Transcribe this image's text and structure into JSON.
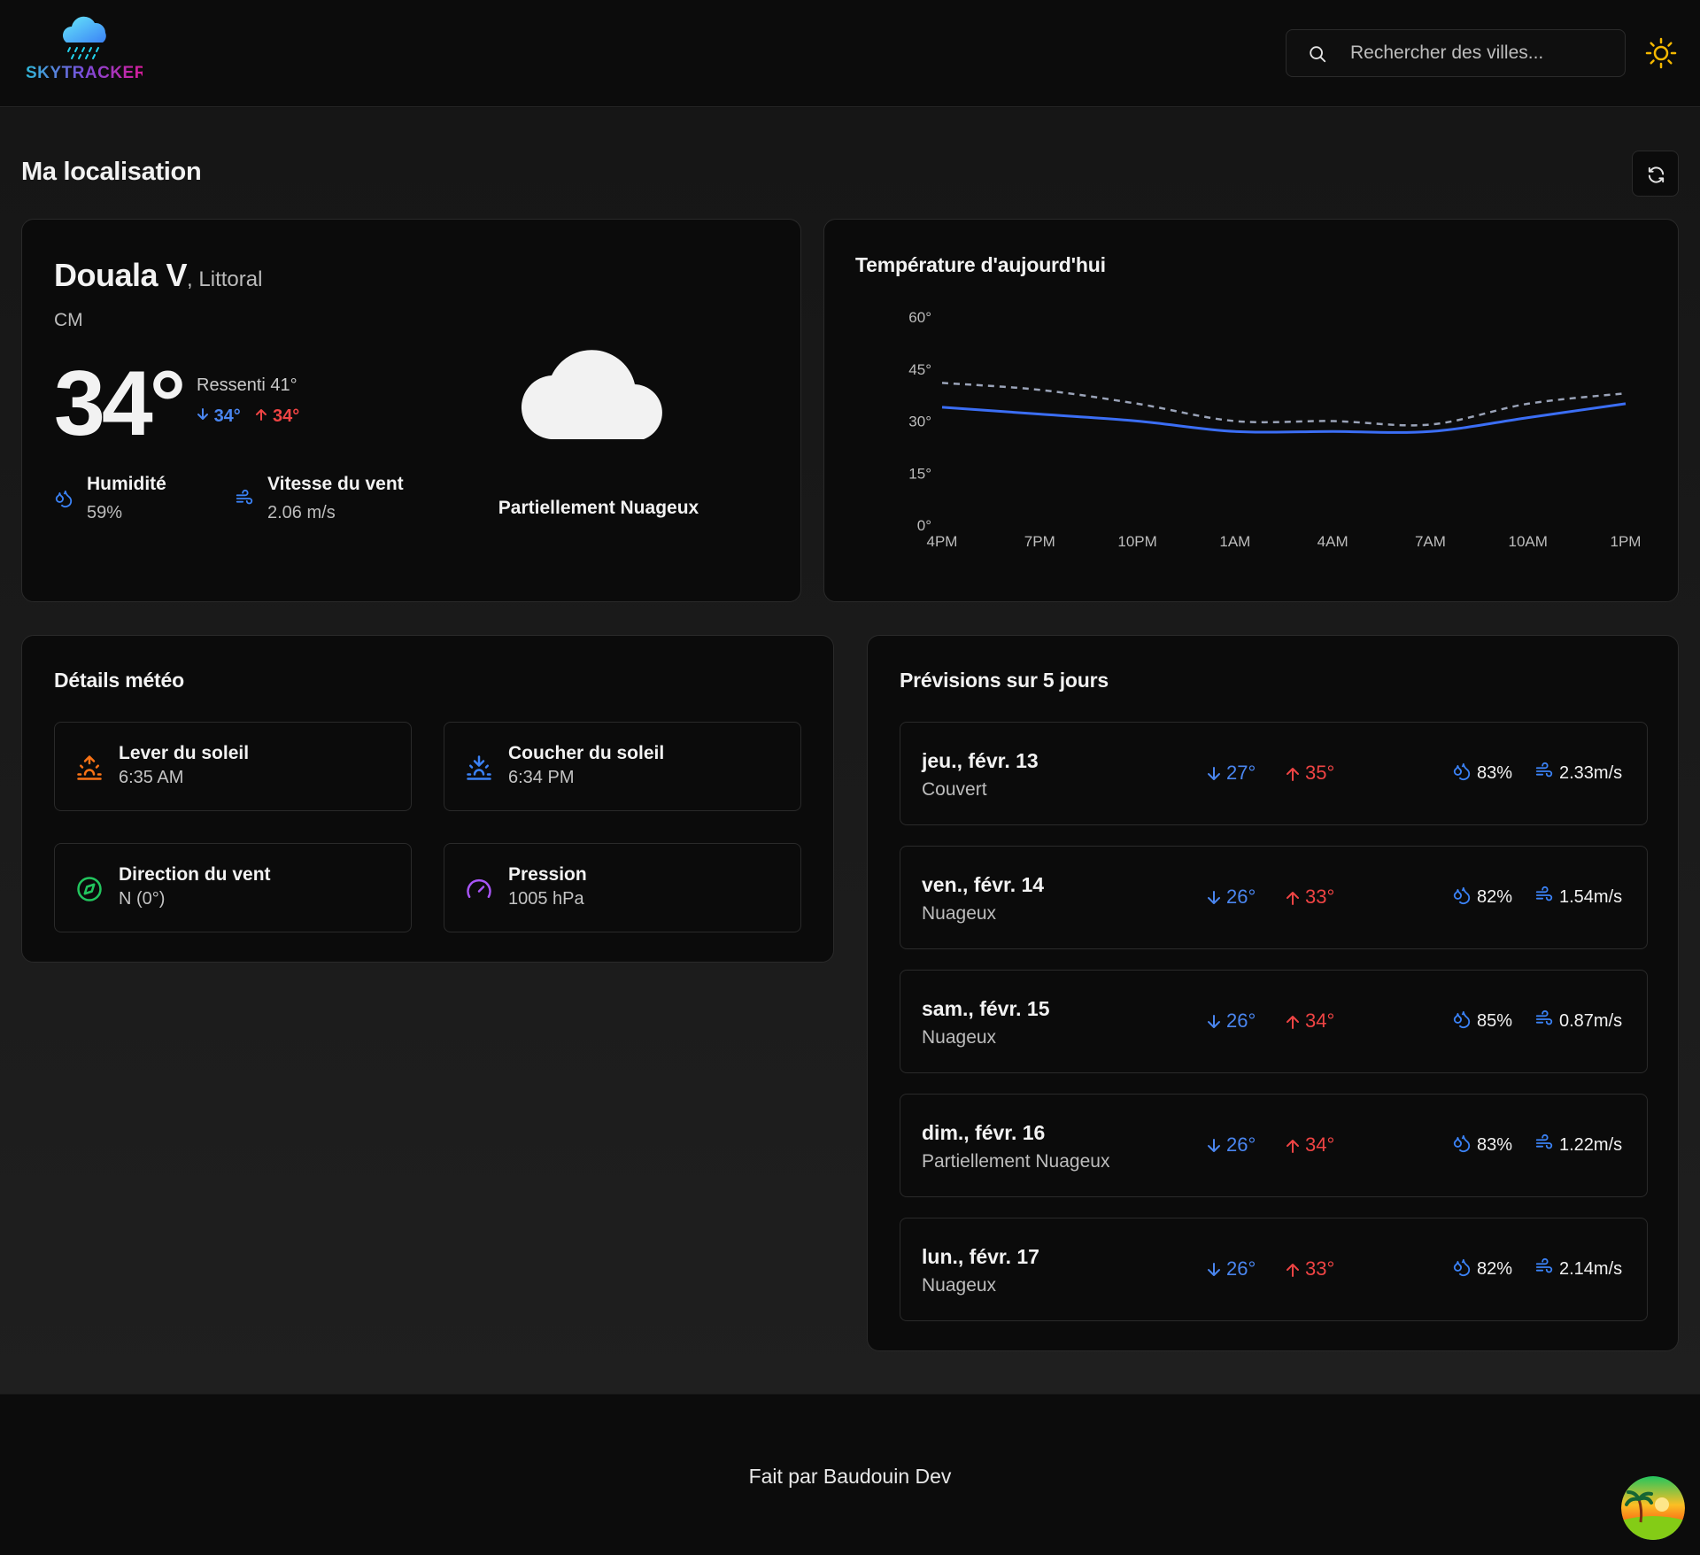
{
  "header": {
    "logo_text": "SKYTRACKER",
    "search_placeholder": "Rechercher des villes..."
  },
  "page": {
    "title": "Ma localisation"
  },
  "current": {
    "city": "Douala V",
    "region": ", Littoral",
    "country": "CM",
    "temperature": "34°",
    "feels_like": "Ressenti 41°",
    "min": "34°",
    "max": "34°",
    "humidity_label": "Humidité",
    "humidity_value": "59%",
    "wind_label": "Vitesse du vent",
    "wind_value": "2.06 m/s",
    "condition": "Partiellement Nuageux"
  },
  "chart_card": {
    "title": "Température d'aujourd'hui"
  },
  "chart_data": {
    "type": "line",
    "x": [
      "4PM",
      "7PM",
      "10PM",
      "1AM",
      "4AM",
      "7AM",
      "10AM",
      "1PM"
    ],
    "y_ticks": [
      "60°",
      "45°",
      "30°",
      "15°",
      "0°"
    ],
    "ylim": [
      0,
      60
    ],
    "series": [
      {
        "values": [
          34,
          32,
          30,
          27,
          27,
          27,
          31,
          35
        ],
        "color": "#3b6ef5",
        "style": "solid"
      },
      {
        "values": [
          41,
          39,
          35,
          30,
          30,
          29,
          35,
          38
        ],
        "color": "#9aa3b8",
        "style": "dashed"
      }
    ]
  },
  "details": {
    "title": "Détails météo",
    "items": [
      {
        "label": "Lever du soleil",
        "value": "6:35 AM",
        "icon": "sunrise-icon",
        "color": "#f97316"
      },
      {
        "label": "Coucher du soleil",
        "value": "6:34 PM",
        "icon": "sunset-icon",
        "color": "#3b82f6"
      },
      {
        "label": "Direction du vent",
        "value": "N (0°)",
        "icon": "compass-icon",
        "color": "#22c55e"
      },
      {
        "label": "Pression",
        "value": "1005 hPa",
        "icon": "gauge-icon",
        "color": "#a855f7"
      }
    ]
  },
  "forecast": {
    "title": "Prévisions sur 5 jours",
    "days": [
      {
        "day": "jeu., févr. 13",
        "condition": "Couvert",
        "low": "27°",
        "high": "35°",
        "humidity": "83%",
        "wind": "2.33m/s"
      },
      {
        "day": "ven., févr. 14",
        "condition": "Nuageux",
        "low": "26°",
        "high": "33°",
        "humidity": "82%",
        "wind": "1.54m/s"
      },
      {
        "day": "sam., févr. 15",
        "condition": "Nuageux",
        "low": "26°",
        "high": "34°",
        "humidity": "85%",
        "wind": "0.87m/s"
      },
      {
        "day": "dim., févr. 16",
        "condition": "Partiellement Nuageux",
        "low": "26°",
        "high": "34°",
        "humidity": "83%",
        "wind": "1.22m/s"
      },
      {
        "day": "lun., févr. 17",
        "condition": "Nuageux",
        "low": "26°",
        "high": "33°",
        "humidity": "82%",
        "wind": "2.14m/s"
      }
    ]
  },
  "footer": {
    "text": "Fait par Baudouin Dev"
  }
}
